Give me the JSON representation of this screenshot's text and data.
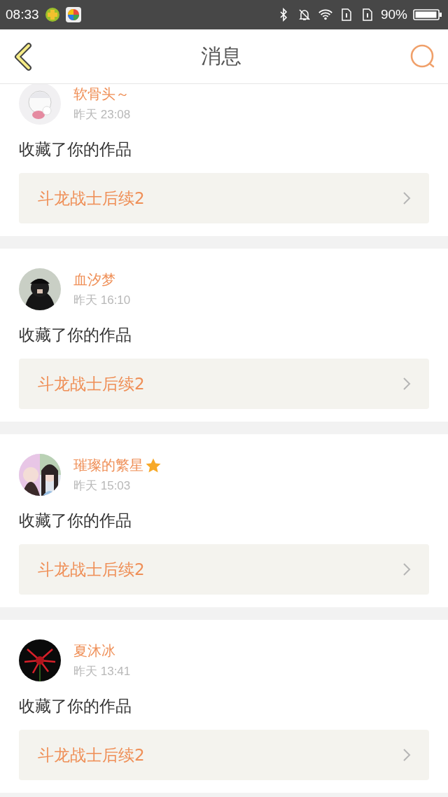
{
  "status_bar": {
    "time": "08:33",
    "battery_text": "90%"
  },
  "header": {
    "title": "消息"
  },
  "messages": [
    {
      "user": "软骨头～",
      "starred": false,
      "time": "昨天 23:08",
      "action": "收藏了你的作品",
      "work": "斗龙战士后续2"
    },
    {
      "user": "血汐梦",
      "starred": false,
      "time": "昨天 16:10",
      "action": "收藏了你的作品",
      "work": "斗龙战士后续2"
    },
    {
      "user": "璀璨的繁星",
      "starred": true,
      "time": "昨天 15:03",
      "action": "收藏了你的作品",
      "work": "斗龙战士后续2"
    },
    {
      "user": "夏沐冰",
      "starred": false,
      "time": "昨天 13:41",
      "action": "收藏了你的作品",
      "work": "斗龙战士后续2"
    }
  ]
}
